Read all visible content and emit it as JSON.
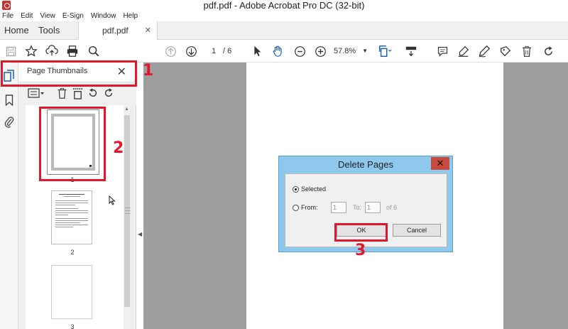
{
  "window": {
    "title": "pdf.pdf - Adobe Acrobat Pro DC (32-bit)"
  },
  "menu": [
    "File",
    "Edit",
    "View",
    "E-Sign",
    "Window",
    "Help"
  ],
  "tabs": {
    "home": "Home",
    "tools": "Tools",
    "document": "pdf.pdf"
  },
  "toolbar": {
    "current_page": "1",
    "page_of": "/ 6",
    "zoom": "57.8%",
    "icons": [
      "save-icon",
      "star-icon",
      "upload-icon",
      "print-icon",
      "find-icon",
      "prev-page-icon",
      "next-page-icon",
      "select-arrow-icon",
      "hand-icon",
      "zoom-out-icon",
      "zoom-in-icon",
      "fit-page-icon",
      "scroll-mode-icon",
      "comment-icon",
      "highlight-icon",
      "sign-icon",
      "edit-icon",
      "delete-icon",
      "rotate-icon"
    ]
  },
  "panel": {
    "title": "Page Thumbnails",
    "thumbnails": [
      {
        "label": "1",
        "selected": true
      },
      {
        "label": "2",
        "selected": false
      },
      {
        "label": "3",
        "selected": false
      }
    ]
  },
  "dialog": {
    "title": "Delete Pages",
    "close_label": "✕",
    "selected_label": "Selected",
    "from_label": "From:",
    "from_value": "1",
    "to_label": "To:",
    "to_value": "1",
    "of_label": "of 6",
    "ok_label": "OK",
    "cancel_label": "Cancel"
  },
  "annotations": {
    "step1": "1",
    "step2": "2",
    "step3": "3"
  },
  "colors": {
    "annotation": "#e3172c",
    "dialog_frame": "#8ec8ec",
    "doc_background": "#9e9e9e"
  }
}
